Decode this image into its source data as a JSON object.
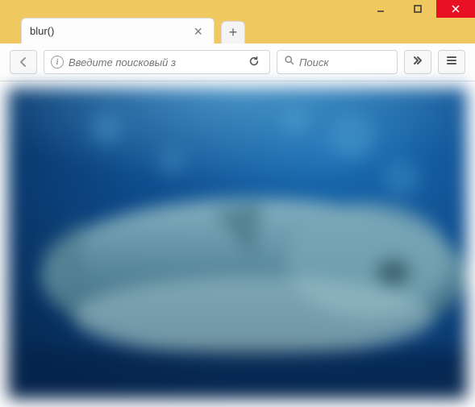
{
  "window": {
    "minimize_label": "Minimize",
    "maximize_label": "Maximize",
    "close_label": "Close"
  },
  "tabs": [
    {
      "title": "blur()"
    }
  ],
  "toolbar": {
    "back_label": "Back",
    "url_placeholder": "Введите поисковый з",
    "reload_label": "Reload",
    "search_placeholder": "Поиск",
    "overflow_label": "More",
    "menu_label": "Menu"
  },
  "content": {
    "image_description": "Blurred underwater photo of a shark",
    "filter": "blur()"
  }
}
